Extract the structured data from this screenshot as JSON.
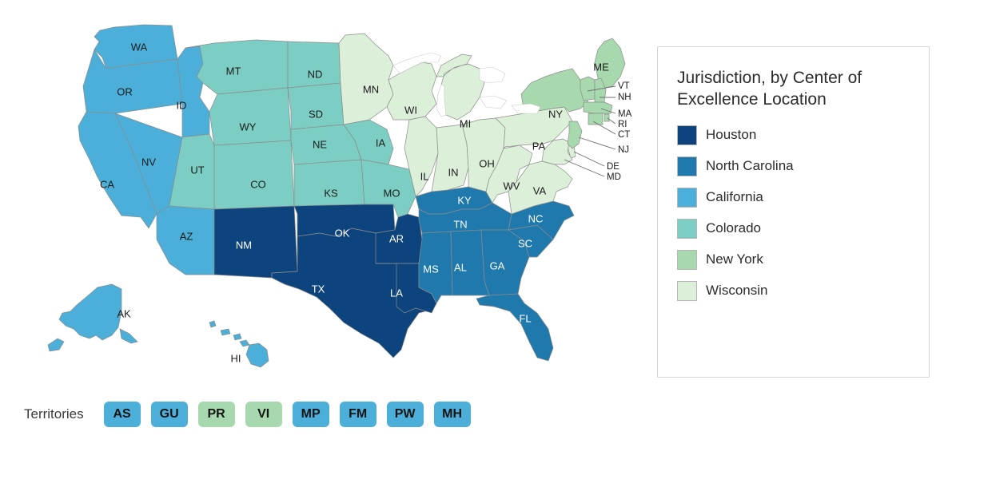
{
  "legend": {
    "title": "Jurisdiction, by Center of Excellence Location",
    "items": [
      {
        "label": "Houston",
        "color": "#0d447e"
      },
      {
        "label": "North Carolina",
        "color": "#2079ad"
      },
      {
        "label": "California",
        "color": "#4bafd9"
      },
      {
        "label": "Colorado",
        "color": "#7ccdc3"
      },
      {
        "label": "New York",
        "color": "#a8d9ae"
      },
      {
        "label": "Wisconsin",
        "color": "#dcefd8"
      }
    ]
  },
  "territories": {
    "label": "Territories",
    "chips": [
      {
        "code": "AS",
        "color": "#4bafd9"
      },
      {
        "code": "GU",
        "color": "#4bafd9"
      },
      {
        "code": "PR",
        "color": "#a8d9ae"
      },
      {
        "code": "VI",
        "color": "#a8d9ae"
      },
      {
        "code": "MP",
        "color": "#4bafd9"
      },
      {
        "code": "FM",
        "color": "#4bafd9"
      },
      {
        "code": "PW",
        "color": "#4bafd9"
      },
      {
        "code": "MH",
        "color": "#4bafd9"
      }
    ]
  },
  "map": {
    "states": [
      {
        "code": "WA",
        "color": "#4bafd9",
        "group": "California"
      },
      {
        "code": "OR",
        "color": "#4bafd9",
        "group": "California"
      },
      {
        "code": "ID",
        "color": "#4bafd9",
        "group": "California"
      },
      {
        "code": "NV",
        "color": "#4bafd9",
        "group": "California"
      },
      {
        "code": "CA",
        "color": "#4bafd9",
        "group": "California"
      },
      {
        "code": "AZ",
        "color": "#4bafd9",
        "group": "California"
      },
      {
        "code": "AK",
        "color": "#4bafd9",
        "group": "California"
      },
      {
        "code": "HI",
        "color": "#4bafd9",
        "group": "California"
      },
      {
        "code": "MT",
        "color": "#7ccdc3",
        "group": "Colorado"
      },
      {
        "code": "WY",
        "color": "#7ccdc3",
        "group": "Colorado"
      },
      {
        "code": "UT",
        "color": "#7ccdc3",
        "group": "Colorado"
      },
      {
        "code": "CO",
        "color": "#7ccdc3",
        "group": "Colorado"
      },
      {
        "code": "ND",
        "color": "#7ccdc3",
        "group": "Colorado"
      },
      {
        "code": "SD",
        "color": "#7ccdc3",
        "group": "Colorado"
      },
      {
        "code": "NE",
        "color": "#7ccdc3",
        "group": "Colorado"
      },
      {
        "code": "KS",
        "color": "#7ccdc3",
        "group": "Colorado"
      },
      {
        "code": "IA",
        "color": "#7ccdc3",
        "group": "Colorado"
      },
      {
        "code": "MO",
        "color": "#7ccdc3",
        "group": "Colorado"
      },
      {
        "code": "NM",
        "color": "#0d447e",
        "group": "Houston"
      },
      {
        "code": "TX",
        "color": "#0d447e",
        "group": "Houston"
      },
      {
        "code": "OK",
        "color": "#0d447e",
        "group": "Houston"
      },
      {
        "code": "AR",
        "color": "#0d447e",
        "group": "Houston"
      },
      {
        "code": "LA",
        "color": "#0d447e",
        "group": "Houston"
      },
      {
        "code": "KY",
        "color": "#2079ad",
        "group": "North Carolina"
      },
      {
        "code": "TN",
        "color": "#2079ad",
        "group": "North Carolina"
      },
      {
        "code": "MS",
        "color": "#2079ad",
        "group": "North Carolina"
      },
      {
        "code": "AL",
        "color": "#2079ad",
        "group": "North Carolina"
      },
      {
        "code": "GA",
        "color": "#2079ad",
        "group": "North Carolina"
      },
      {
        "code": "FL",
        "color": "#2079ad",
        "group": "North Carolina"
      },
      {
        "code": "SC",
        "color": "#2079ad",
        "group": "North Carolina"
      },
      {
        "code": "NC",
        "color": "#2079ad",
        "group": "North Carolina"
      },
      {
        "code": "MN",
        "color": "#dcefd8",
        "group": "Wisconsin"
      },
      {
        "code": "WI",
        "color": "#dcefd8",
        "group": "Wisconsin"
      },
      {
        "code": "MI",
        "color": "#dcefd8",
        "group": "Wisconsin"
      },
      {
        "code": "IL",
        "color": "#dcefd8",
        "group": "Wisconsin"
      },
      {
        "code": "IN",
        "color": "#dcefd8",
        "group": "Wisconsin"
      },
      {
        "code": "OH",
        "color": "#dcefd8",
        "group": "Wisconsin"
      },
      {
        "code": "PA",
        "color": "#dcefd8",
        "group": "Wisconsin"
      },
      {
        "code": "WV",
        "color": "#dcefd8",
        "group": "Wisconsin"
      },
      {
        "code": "VA",
        "color": "#dcefd8",
        "group": "Wisconsin"
      },
      {
        "code": "DE",
        "color": "#dcefd8",
        "group": "Wisconsin"
      },
      {
        "code": "MD",
        "color": "#dcefd8",
        "group": "Wisconsin"
      },
      {
        "code": "NY",
        "color": "#a8d9ae",
        "group": "New York"
      },
      {
        "code": "ME",
        "color": "#a8d9ae",
        "group": "New York"
      },
      {
        "code": "VT",
        "color": "#a8d9ae",
        "group": "New York"
      },
      {
        "code": "NH",
        "color": "#a8d9ae",
        "group": "New York"
      },
      {
        "code": "MA",
        "color": "#a8d9ae",
        "group": "New York"
      },
      {
        "code": "RI",
        "color": "#a8d9ae",
        "group": "New York"
      },
      {
        "code": "CT",
        "color": "#a8d9ae",
        "group": "New York"
      },
      {
        "code": "NJ",
        "color": "#a8d9ae",
        "group": "New York"
      }
    ],
    "leader_labels": [
      "VT",
      "NH",
      "MA",
      "RI",
      "CT",
      "NJ",
      "DE",
      "MD"
    ]
  }
}
